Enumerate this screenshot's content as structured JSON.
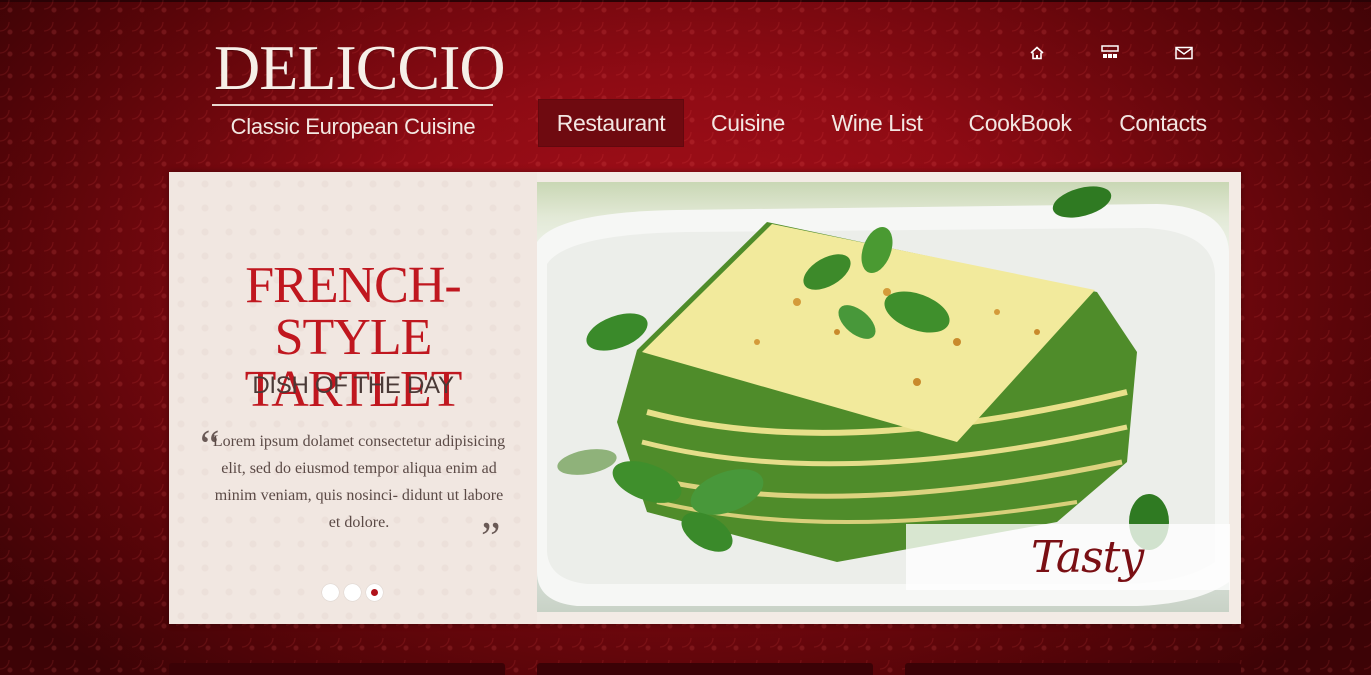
{
  "brand": {
    "name": "DELICCIO",
    "tagline": "Classic European Cuisine"
  },
  "top_icons": [
    {
      "icon": "home-icon"
    },
    {
      "icon": "sitemap-icon"
    },
    {
      "icon": "mail-icon"
    }
  ],
  "nav": {
    "items": [
      {
        "label": "Restaurant",
        "active": true
      },
      {
        "label": "Cuisine",
        "active": false
      },
      {
        "label": "Wine List",
        "active": false
      },
      {
        "label": "CookBook",
        "active": false
      },
      {
        "label": "Contacts",
        "active": false
      }
    ]
  },
  "slider": {
    "headline_line1": "FRENCH-STYLE",
    "headline_line2": "TARTLET",
    "subheading": "DISH OF THE DAY",
    "quote": "Lorem ipsum dolamet consectetur adipisicing elit, sed do eiusmod tempor aliqua enim ad minim veniam, quis nosinci- didunt ut labore et dolore.",
    "quote_open": "“",
    "quote_close": "”",
    "tasty_label": "Tasty",
    "slide_count": 3,
    "active_slide": 3
  },
  "colors": {
    "accent": "#c0171f",
    "background": "#8e0b14",
    "nav_active": "#6f0a10"
  }
}
